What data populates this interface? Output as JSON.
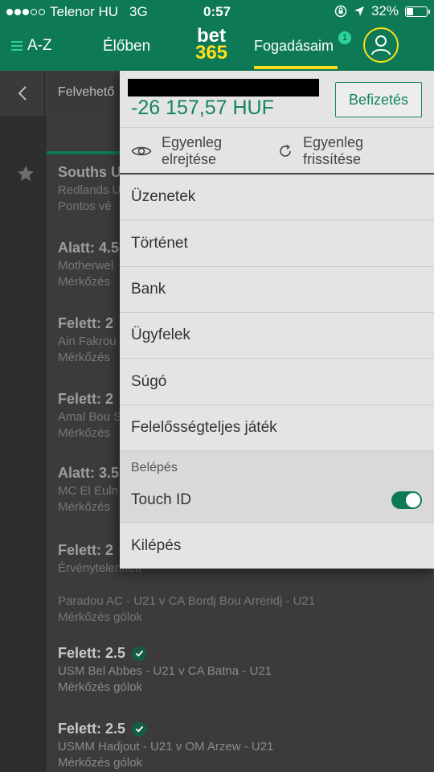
{
  "status_bar": {
    "carrier": "Telenor HU",
    "network": "3G",
    "time": "0:57",
    "battery": "32%",
    "battery_level": 0.32,
    "signal_bars": 3
  },
  "header": {
    "az_label": "A-Z",
    "live_label": "Élőben",
    "logo_top": "bet",
    "logo_bottom": "365",
    "my_bets_label": "Fogadásaim",
    "my_bets_badge": "1"
  },
  "subheader": {
    "label": "Felvehető"
  },
  "background_bets": [
    {
      "title": "Souths U",
      "line1": "Redlands U",
      "line2": "Pontos vé"
    },
    {
      "title": "Alatt: 4.5",
      "line1": "Motherwel",
      "line2": "Mérkőzés"
    },
    {
      "title": "Felett: 2",
      "line1": "Ain Fakrou",
      "line2": "Mérkőzés"
    },
    {
      "title": "Felett: 2",
      "line1": "Amal Bou S",
      "line2": "Mérkőzés"
    },
    {
      "title": "Alatt: 3.5",
      "line1": "MC El Euln",
      "line2": "Mérkőzés"
    },
    {
      "title": "Felett: 2",
      "line1": "Érvénytelenített",
      "line2": ""
    },
    {
      "title": "",
      "line1": "Paradou AC - U21 v CA Bordj Bou Arreridj - U21",
      "line2": "Mérkőzés gólok"
    },
    {
      "title": "Felett: 2.5",
      "line1": "USM Bel Abbes - U21 v CA Batna - U21",
      "line2": "Mérkőzés gólok"
    },
    {
      "title": "Felett: 2.5",
      "line1": "USMM Hadjout - U21 v OM Arzew - U21",
      "line2": "Mérkőzés gólok"
    }
  ],
  "account_menu": {
    "balance": "-26 157,57 HUF",
    "deposit_label": "Befizetés",
    "hide_balance_line1": "Egyenleg",
    "hide_balance_line2": "elrejtése",
    "refresh_balance_line1": "Egyenleg",
    "refresh_balance_line2": "frissítése",
    "items": [
      {
        "label": "Üzenetek"
      },
      {
        "label": "Történet"
      },
      {
        "label": "Bank"
      },
      {
        "label": "Ügyfelek"
      },
      {
        "label": "Súgó"
      },
      {
        "label": "Felelősségteljes játék"
      }
    ],
    "login_section_label": "Belépés",
    "touch_id_label": "Touch ID",
    "touch_id_enabled": true,
    "logout_label": "Kilépés"
  },
  "colors": {
    "brand_green": "#0d7a55",
    "accent_green": "#2bd49a",
    "brand_yellow": "#ffdf1b",
    "balance_green": "#15845f"
  }
}
